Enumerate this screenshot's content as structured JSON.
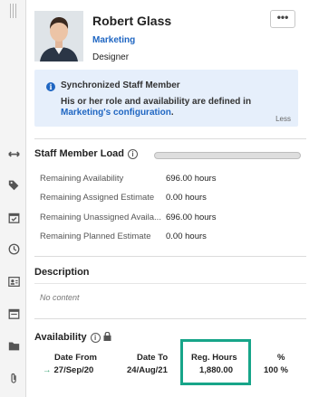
{
  "profile": {
    "name": "Robert Glass",
    "department": "Marketing",
    "role": "Designer",
    "more_label": "•••"
  },
  "info_box": {
    "title": "Synchronized Staff Member",
    "line1": "His or her role and availability are defined in",
    "link_text": "Marketing's configuration",
    "line2_suffix": ".",
    "toggle_label": "Less",
    "icon": "info-icon"
  },
  "staff_load": {
    "title": "Staff Member Load",
    "rows": [
      {
        "label": "Remaining Availability",
        "value": "696.00 hours"
      },
      {
        "label": "Remaining Assigned Estimate",
        "value": "0.00 hours"
      },
      {
        "label": "Remaining Unassigned Availa...",
        "value": "696.00 hours"
      },
      {
        "label": "Remaining Planned Estimate",
        "value": "0.00 hours"
      }
    ]
  },
  "description": {
    "title": "Description",
    "content": "No content"
  },
  "availability": {
    "title": "Availability",
    "columns": {
      "date_from": "Date From",
      "date_to": "Date To",
      "reg_hours": "Reg. Hours",
      "percent": "%"
    },
    "row": {
      "date_from": "27/Sep/20",
      "date_to": "24/Aug/21",
      "reg_hours": "1,880.00",
      "percent": "100 %"
    }
  },
  "colors": {
    "link": "#1f66c2",
    "info_bg": "#e6effb",
    "highlight": "#17a589",
    "arrow": "#2e9d6a"
  },
  "rail_icons": [
    "resize-handle-icon",
    "tag-icon",
    "calendar-check-icon",
    "clock-icon",
    "contact-card-icon",
    "calendar-icon",
    "folder-icon",
    "paperclip-icon"
  ]
}
